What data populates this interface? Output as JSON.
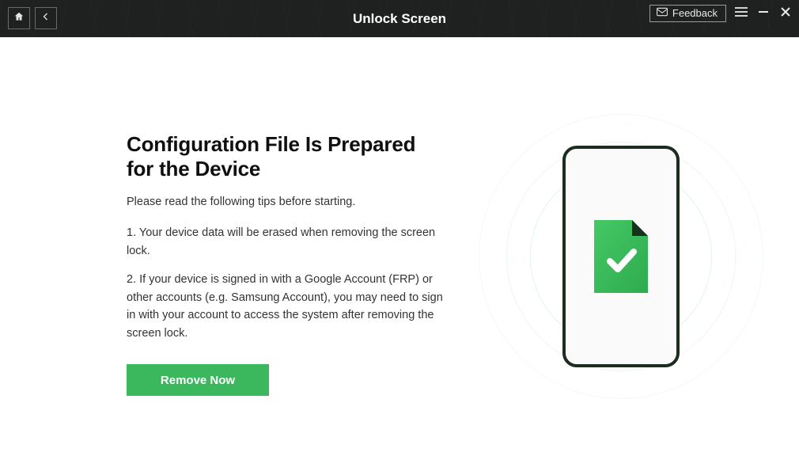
{
  "header": {
    "title": "Unlock Screen",
    "feedback_label": "Feedback"
  },
  "main": {
    "heading": "Configuration File Is Prepared for the Device",
    "subtext": "Please read the following tips before starting.",
    "tip1": "1. Your device data will be erased when removing the screen lock.",
    "tip2": "2. If your device is signed in with a Google Account (FRP) or other accounts (e.g. Samsung Account), you may need to sign in with your account to access the system after removing the screen lock.",
    "remove_button": "Remove Now"
  },
  "colors": {
    "accent": "#3bb75e",
    "header_bg": "#1f2121"
  }
}
